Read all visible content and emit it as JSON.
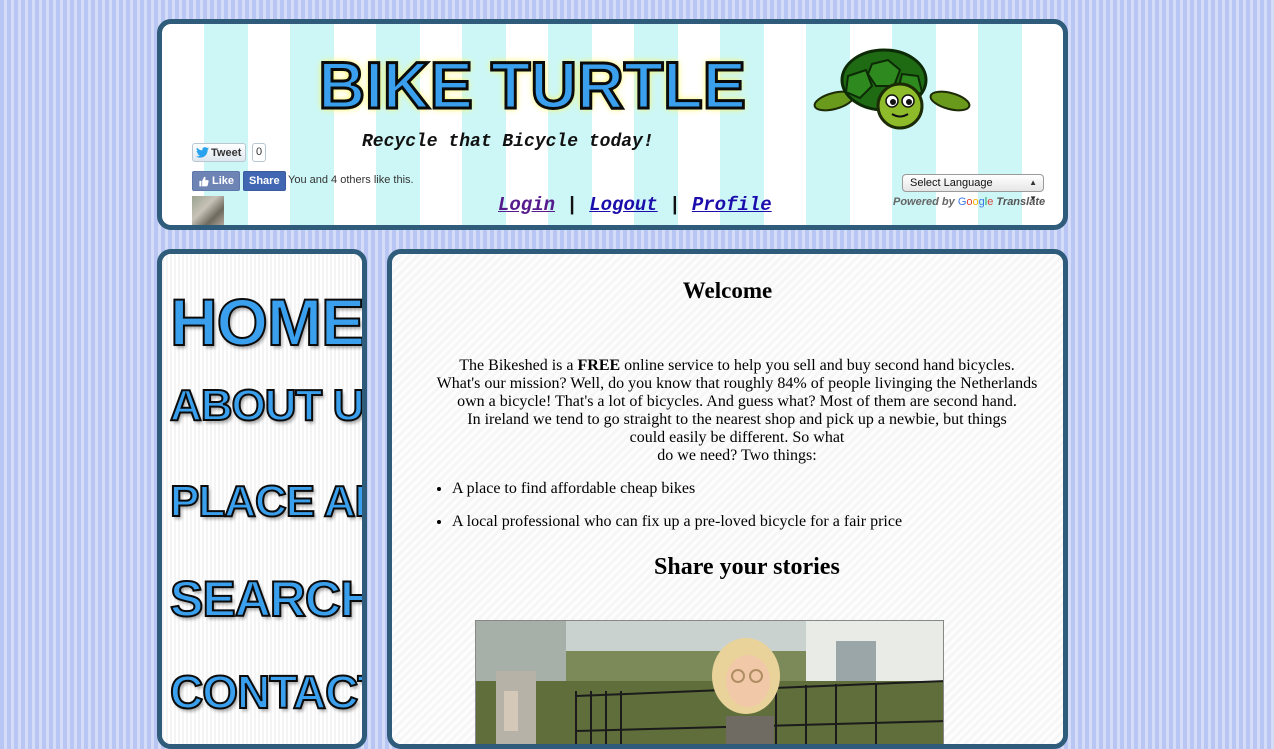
{
  "header": {
    "logo_text": "BIKE TURTLE",
    "tagline": "Recycle that Bicycle today!",
    "tweet_label": "Tweet",
    "tweet_count": "0",
    "fb_like_label": "Like",
    "fb_share_label": "Share",
    "fb_social_text": "You and 4 others like this.",
    "nav": {
      "login": "Login",
      "logout": "Logout",
      "profile": "Profile",
      "separator": "|"
    },
    "translate": {
      "select_value": "Select Language",
      "powered_by": "Powered by",
      "google": [
        "G",
        "o",
        "o",
        "g",
        "l",
        "e"
      ],
      "translate_word": "Translate"
    }
  },
  "sidebar": {
    "items": [
      {
        "label": "HOME"
      },
      {
        "label": "ABOUT US"
      },
      {
        "label": "PLACE AD"
      },
      {
        "label": "SEARCH"
      },
      {
        "label": "CONTACT"
      }
    ]
  },
  "main": {
    "welcome_title": "Welcome",
    "intro_lines": {
      "line1_before": "The Bikeshed is a ",
      "line1_bold": "FREE",
      "line1_after": " online service to help you sell and buy second hand bicycles.",
      "line2": "What's our mission? Well, do you know that roughly 84% of people livinging the Netherlands",
      "line3": "own a bicycle! That's a lot of bicycles. And guess what? Most of them are second hand.",
      "line4": "In ireland we tend to go straight to the nearest shop and pick up a newbie, but things",
      "line5": "could easily be different. So what",
      "line6": "do we need? Two things:"
    },
    "bullets": [
      "A place to find affordable cheap bikes",
      "A local professional who can fix up a pre-loved bicycle for a fair price"
    ],
    "share_title": "Share your stories"
  },
  "colors": {
    "border": "#2f5c7b",
    "logo_fill": "#3aa0ee",
    "link": "#1a0dab",
    "visited_link": "#551a8b"
  }
}
